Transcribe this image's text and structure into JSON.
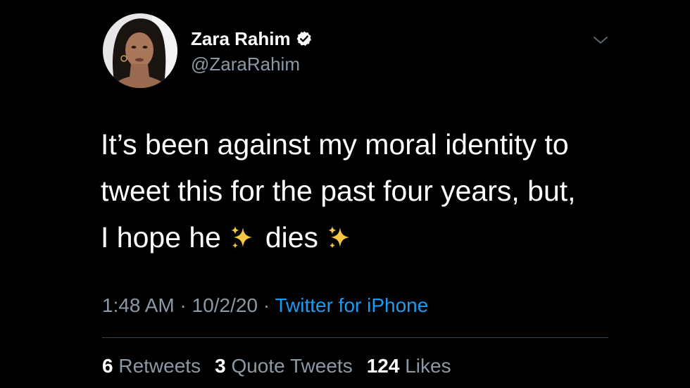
{
  "user": {
    "display_name": "Zara Rahim",
    "handle": "@ZaraRahim",
    "verified": true
  },
  "tweet": {
    "lines": [
      "It’s been against my moral identity to",
      "tweet this for the past four years, but,"
    ],
    "line3_start": "I hope he",
    "line3_mid": "dies",
    "sparkle_icon": "sparkles-emoji"
  },
  "meta": {
    "time": "1:48 AM",
    "sep1": " · ",
    "date": "10/2/20",
    "sep2": " · ",
    "source": "Twitter for iPhone"
  },
  "stats": {
    "retweets_count": "6",
    "retweets_label": "Retweets",
    "quotes_count": "3",
    "quotes_label": "Quote Tweets",
    "likes_count": "124",
    "likes_label": "Likes"
  },
  "colors": {
    "background": "#000000",
    "text_primary": "#ffffff",
    "text_secondary": "#8b98a5",
    "link": "#1d9bf0",
    "divider": "#38444d"
  }
}
